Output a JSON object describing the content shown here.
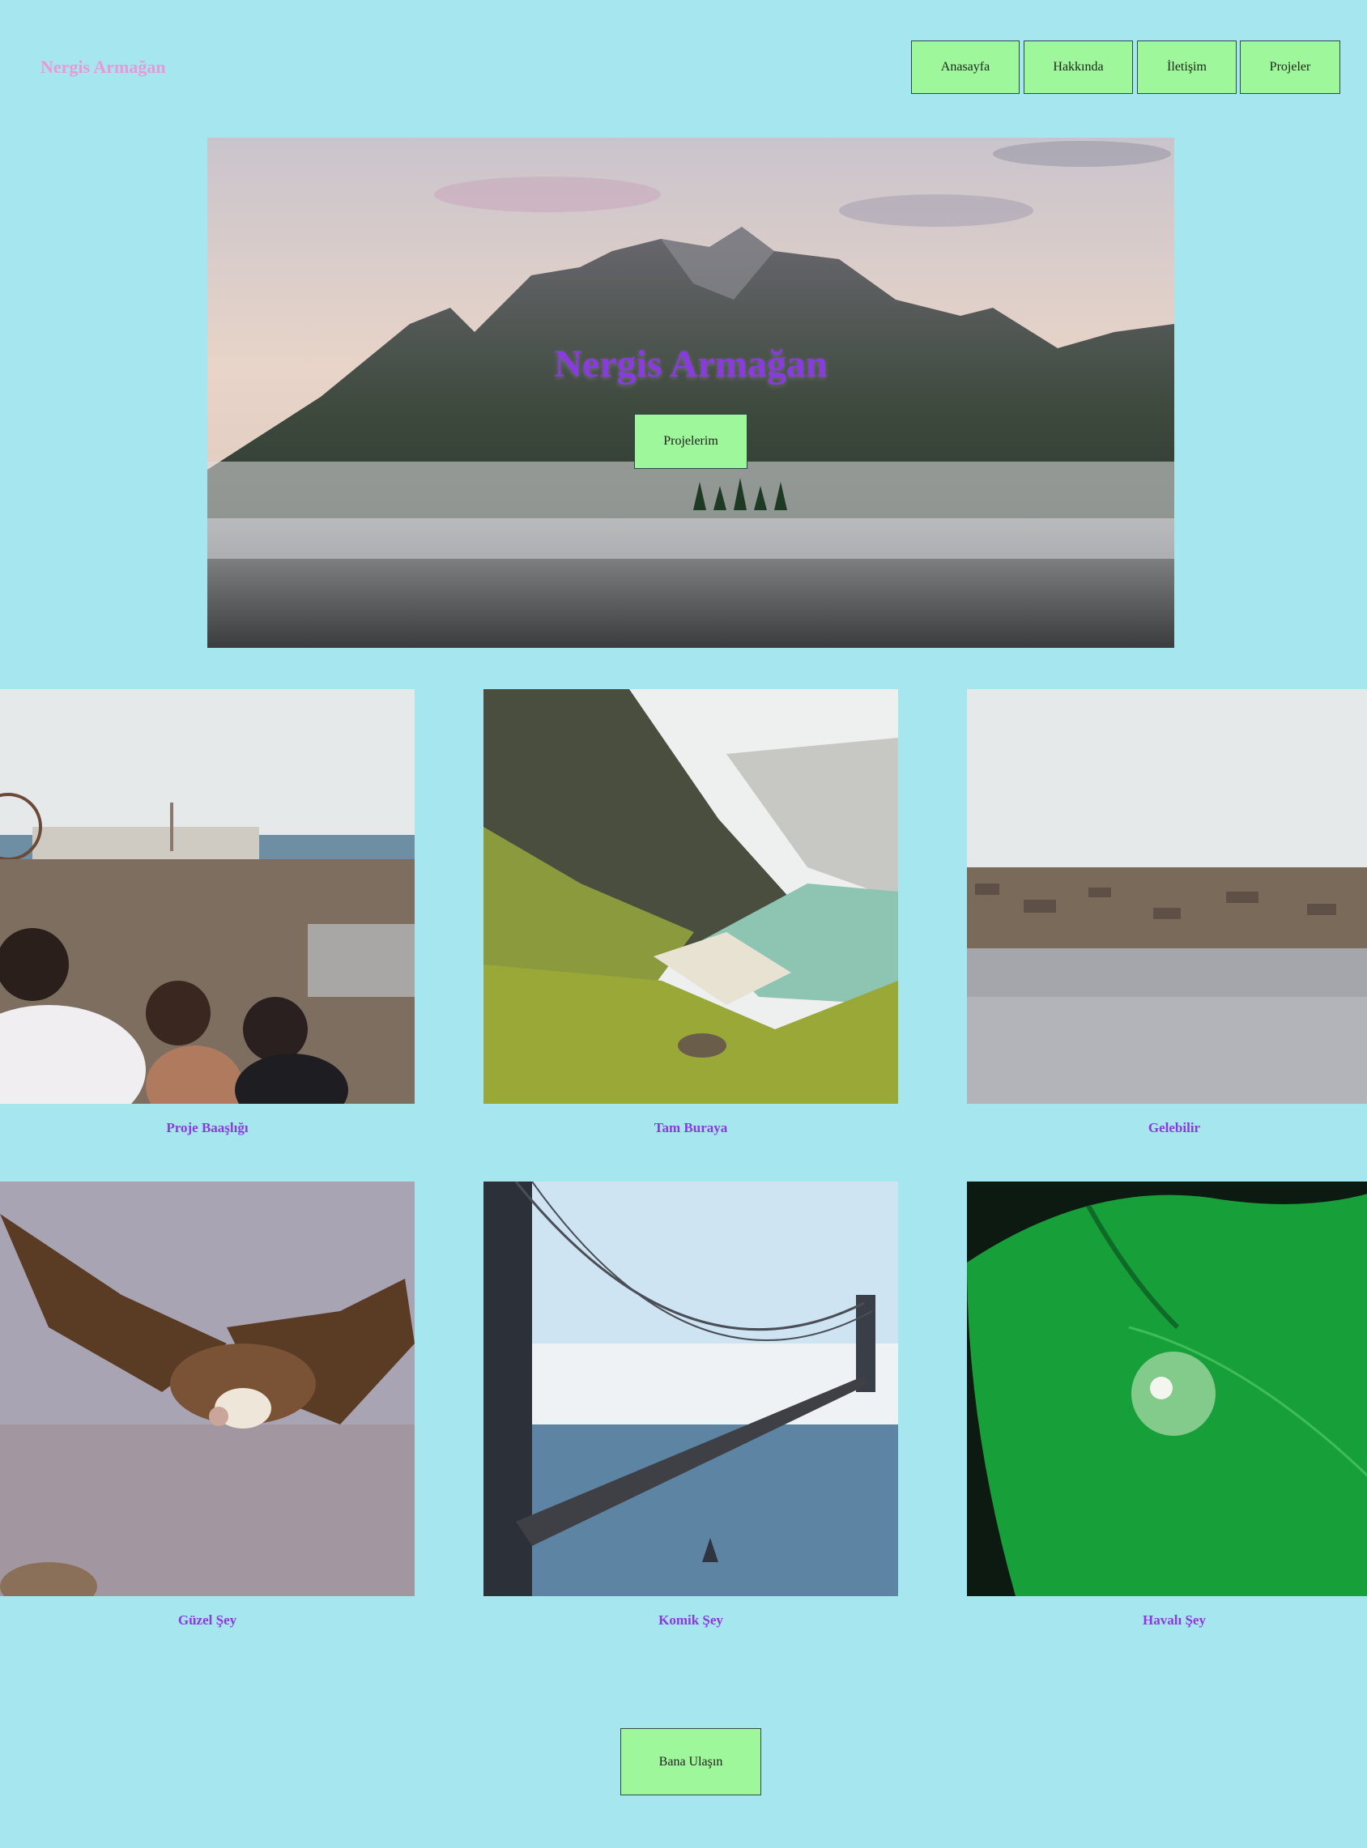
{
  "brand": "Nergis Armağan",
  "nav": [
    "Anasayfa",
    "Hakkında",
    "İletişim",
    "Projeler"
  ],
  "hero": {
    "title": "Nergis Armağan",
    "button": "Projelerim"
  },
  "projects": [
    {
      "title": "Proje Baaşlığı",
      "image": "crowd-boardwalk-photo"
    },
    {
      "title": "Tam Buraya",
      "image": "coastal-valley-photo"
    },
    {
      "title": "Gelebilir",
      "image": "stone-breakwater-photo"
    },
    {
      "title": "Güzel Şey",
      "image": "vulture-photo"
    },
    {
      "title": "Komik Şey",
      "image": "suspension-bridge-photo"
    },
    {
      "title": "Havalı Şey",
      "image": "leaf-water-drop-photo"
    }
  ],
  "contact_button": "Bana Ulaşın"
}
